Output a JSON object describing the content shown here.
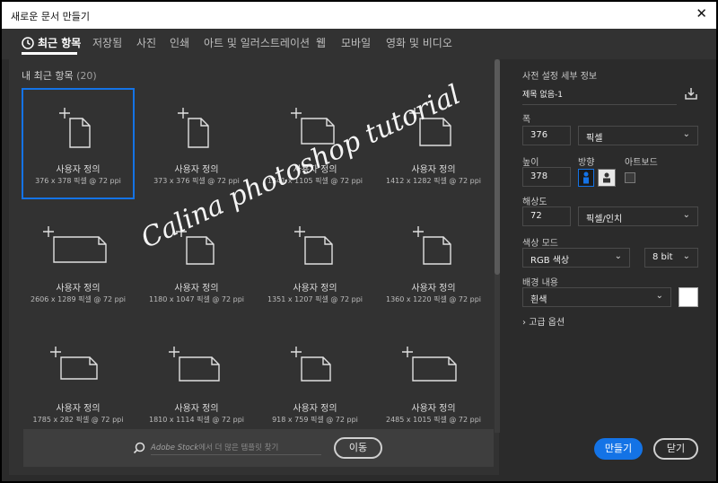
{
  "window": {
    "title": "새로운 문서 만들기",
    "close_glyph": "✕"
  },
  "tabs": [
    "최근 항목",
    "저장됨",
    "사진",
    "인쇄",
    "아트 및 일러스트레이션",
    "웹",
    "모바일",
    "영화 및 비디오"
  ],
  "recent": {
    "title": "내 최근 항목",
    "count": "(20)",
    "items": [
      {
        "label": "사용자 정의",
        "dims": "376 x 378 픽셀 @ 72 ppi"
      },
      {
        "label": "사용자 정의",
        "dims": "373 x 376 픽셀 @ 72 ppi"
      },
      {
        "label": "사용자 정의",
        "dims": "1541 x 1105 픽셀 @ 72 ppi"
      },
      {
        "label": "사용자 정의",
        "dims": "1412 x 1282 픽셀 @ 72 ppi"
      },
      {
        "label": "사용자 정의",
        "dims": "2606 x 1289 픽셀 @ 72 ppi"
      },
      {
        "label": "사용자 정의",
        "dims": "1180 x 1047 픽셀 @ 72 ppi"
      },
      {
        "label": "사용자 정의",
        "dims": "1351 x 1207 픽셀 @ 72 ppi"
      },
      {
        "label": "사용자 정의",
        "dims": "1360 x 1220 픽셀 @ 72 ppi"
      },
      {
        "label": "사용자 정의",
        "dims": "1785 x 282 픽셀 @ 72 ppi"
      },
      {
        "label": "사용자 정의",
        "dims": "1810 x 1114 픽셀 @ 72 ppi"
      },
      {
        "label": "사용자 정의",
        "dims": "918 x 759 픽셀 @ 72 ppi"
      },
      {
        "label": "사용자 정의",
        "dims": "2485 x 1015 픽셀 @ 72 ppi"
      }
    ]
  },
  "stock": {
    "placeholder_brand": "Adobe Stock",
    "placeholder_rest": "에서 더 많은 템플릿 찾기",
    "go_label": "이동"
  },
  "details": {
    "header": "사전 설정 세부 정보",
    "name": "제목 없음-1",
    "width_label": "폭",
    "width_value": "376",
    "width_unit": "픽셀",
    "height_label": "높이",
    "height_value": "378",
    "orientation_label": "방향",
    "artboard_label": "아트보드",
    "resolution_label": "해상도",
    "resolution_value": "72",
    "resolution_unit": "픽셀/인치",
    "color_mode_label": "색상 모드",
    "color_mode_value": "RGB 색상",
    "bit_depth": "8 bit",
    "background_label": "배경 내용",
    "background_value": "흰색",
    "advanced_label": "고급 옵션"
  },
  "actions": {
    "create_label": "만들기",
    "close_label": "닫기"
  },
  "watermark": "Calina photoshop tutorial",
  "colors": {
    "accent": "#1473e6",
    "panel": "#323232",
    "bg": "#2b2b2b"
  }
}
